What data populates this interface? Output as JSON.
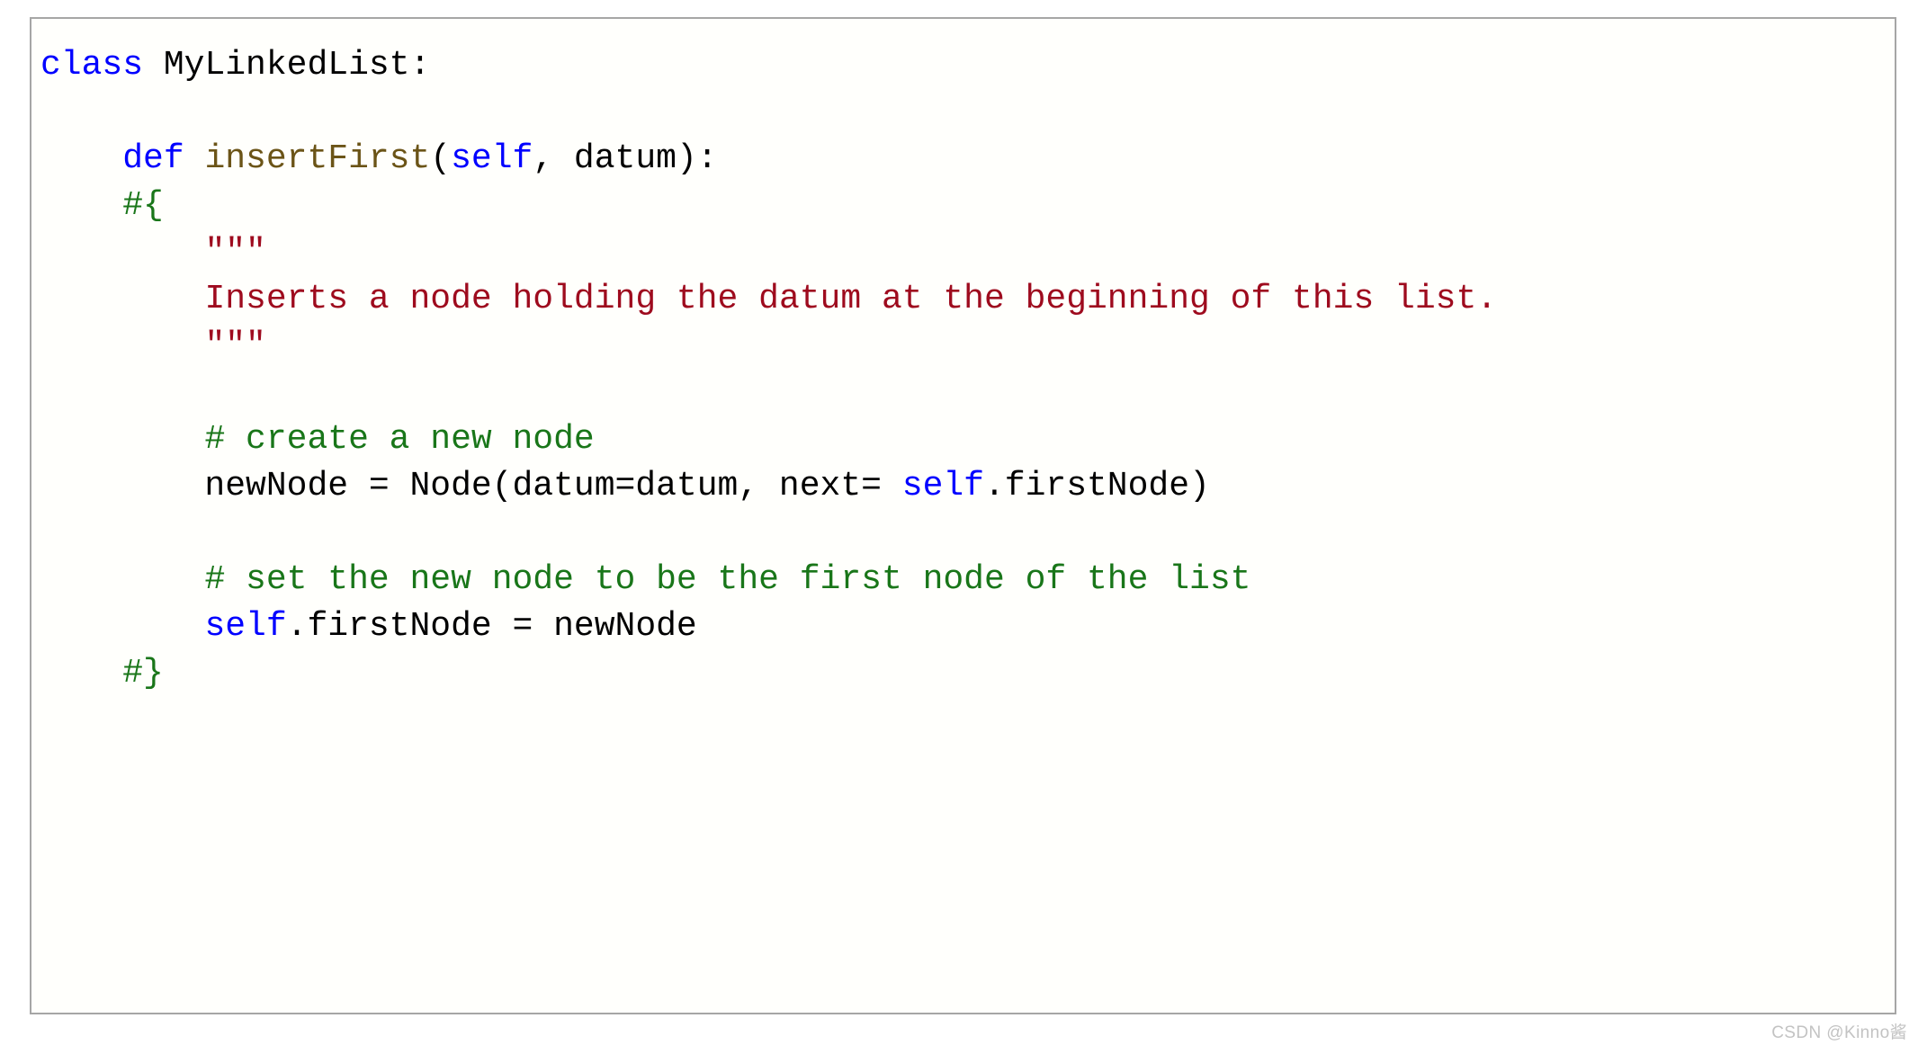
{
  "code_block": {
    "language": "python",
    "colors": {
      "keyword": "#0000ff",
      "function_name": "#6b5417",
      "comment": "#197619",
      "string": "#9e0b1e",
      "plain": "#000000",
      "background": "#fffffc",
      "border": "#a6a6a6"
    },
    "lines": [
      {
        "id": "line-1",
        "tokens": [
          {
            "t": "class",
            "c": "kw"
          },
          {
            "t": " MyLinkedList:",
            "c": "pl"
          }
        ]
      },
      {
        "id": "line-2",
        "tokens": [
          {
            "t": "",
            "c": "pl"
          }
        ]
      },
      {
        "id": "line-3",
        "tokens": [
          {
            "t": "    ",
            "c": "pl"
          },
          {
            "t": "def",
            "c": "kw"
          },
          {
            "t": " ",
            "c": "pl"
          },
          {
            "t": "insertFirst",
            "c": "fn"
          },
          {
            "t": "(",
            "c": "pl"
          },
          {
            "t": "self",
            "c": "kw"
          },
          {
            "t": ", datum):",
            "c": "pl"
          }
        ]
      },
      {
        "id": "line-4",
        "tokens": [
          {
            "t": "    ",
            "c": "pl"
          },
          {
            "t": "#{",
            "c": "cmt"
          }
        ]
      },
      {
        "id": "line-5",
        "tokens": [
          {
            "t": "        ",
            "c": "pl"
          },
          {
            "t": "\"\"\"",
            "c": "str"
          }
        ]
      },
      {
        "id": "line-6",
        "tokens": [
          {
            "t": "        ",
            "c": "pl"
          },
          {
            "t": "Inserts a node holding the datum at the beginning of this list.",
            "c": "str"
          }
        ]
      },
      {
        "id": "line-7",
        "tokens": [
          {
            "t": "        ",
            "c": "pl"
          },
          {
            "t": "\"\"\"",
            "c": "str"
          }
        ]
      },
      {
        "id": "line-8",
        "tokens": [
          {
            "t": "",
            "c": "pl"
          }
        ]
      },
      {
        "id": "line-9",
        "tokens": [
          {
            "t": "        ",
            "c": "pl"
          },
          {
            "t": "# create a new node",
            "c": "cmt"
          }
        ]
      },
      {
        "id": "line-10",
        "tokens": [
          {
            "t": "        newNode = Node(datum=datum, next= ",
            "c": "pl"
          },
          {
            "t": "self",
            "c": "kw"
          },
          {
            "t": ".firstNode)",
            "c": "pl"
          }
        ]
      },
      {
        "id": "line-11",
        "tokens": [
          {
            "t": "",
            "c": "pl"
          }
        ]
      },
      {
        "id": "line-12",
        "tokens": [
          {
            "t": "        ",
            "c": "pl"
          },
          {
            "t": "# set the new node to be the first node of the list",
            "c": "cmt"
          }
        ]
      },
      {
        "id": "line-13",
        "tokens": [
          {
            "t": "        ",
            "c": "pl"
          },
          {
            "t": "self",
            "c": "kw"
          },
          {
            "t": ".firstNode = newNode",
            "c": "pl"
          }
        ]
      },
      {
        "id": "line-14",
        "tokens": [
          {
            "t": "    ",
            "c": "pl"
          },
          {
            "t": "#}",
            "c": "cmt"
          }
        ]
      }
    ]
  },
  "watermark": {
    "text": "CSDN @Kinno酱"
  }
}
